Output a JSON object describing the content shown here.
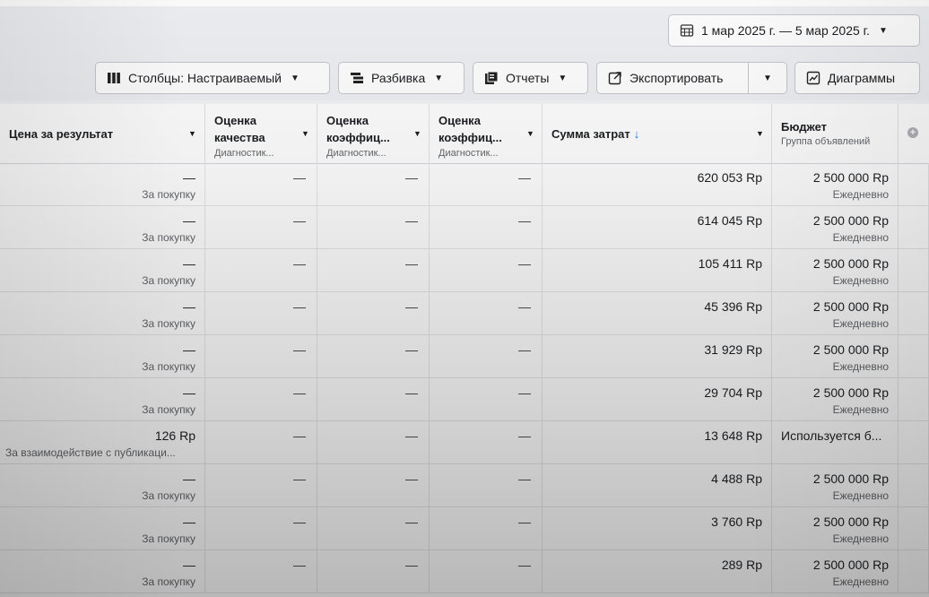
{
  "toolbar": {
    "date_range": "1 мар 2025 г. — 5 мар 2025 г.",
    "columns_label": "Столбцы: Настраиваемый",
    "breakdown_label": "Разбивка",
    "reports_label": "Отчеты",
    "export_label": "Экспортировать",
    "charts_label": "Диаграммы",
    "icons": [
      "calendar-icon",
      "columns-icon",
      "breakdown-icon",
      "reports-icon",
      "export-icon",
      "chart-icon"
    ]
  },
  "table": {
    "headers": {
      "price": "Цена за результат",
      "quality": "Оценка качества",
      "quality_sub": "Диагностик...",
      "engagement": "Оценка коэффиц...",
      "engagement_sub": "Диагностик...",
      "conversion": "Оценка коэффиц...",
      "conversion_sub": "Диагностик...",
      "spend": "Сумма затрат",
      "spend_sort": "↓",
      "budget": "Бюджет",
      "budget_sub": "Группа объявлений"
    },
    "rows": [
      {
        "price": "—",
        "price_sub": "За покупку",
        "quality": "—",
        "engagement": "—",
        "conversion": "—",
        "spend": "620 053 Rp",
        "budget": "2 500 000 Rp",
        "budget_sub": "Ежедневно"
      },
      {
        "price": "—",
        "price_sub": "За покупку",
        "quality": "—",
        "engagement": "—",
        "conversion": "—",
        "spend": "614 045 Rp",
        "budget": "2 500 000 Rp",
        "budget_sub": "Ежедневно"
      },
      {
        "price": "—",
        "price_sub": "За покупку",
        "quality": "—",
        "engagement": "—",
        "conversion": "—",
        "spend": "105 411 Rp",
        "budget": "2 500 000 Rp",
        "budget_sub": "Ежедневно"
      },
      {
        "price": "—",
        "price_sub": "За покупку",
        "quality": "—",
        "engagement": "—",
        "conversion": "—",
        "spend": "45 396 Rp",
        "budget": "2 500 000 Rp",
        "budget_sub": "Ежедневно"
      },
      {
        "price": "—",
        "price_sub": "За покупку",
        "quality": "—",
        "engagement": "—",
        "conversion": "—",
        "spend": "31 929 Rp",
        "budget": "2 500 000 Rp",
        "budget_sub": "Ежедневно"
      },
      {
        "price": "—",
        "price_sub": "За покупку",
        "quality": "—",
        "engagement": "—",
        "conversion": "—",
        "spend": "29 704 Rp",
        "budget": "2 500 000 Rp",
        "budget_sub": "Ежедневно"
      },
      {
        "price": "126 Rp",
        "price_sub": "За взаимодействие с публикаци...",
        "quality": "—",
        "engagement": "—",
        "conversion": "—",
        "spend": "13 648 Rp",
        "budget": "Используется б...",
        "budget_sub": ""
      },
      {
        "price": "—",
        "price_sub": "За покупку",
        "quality": "—",
        "engagement": "—",
        "conversion": "—",
        "spend": "4 488 Rp",
        "budget": "2 500 000 Rp",
        "budget_sub": "Ежедневно"
      },
      {
        "price": "—",
        "price_sub": "За покупку",
        "quality": "—",
        "engagement": "—",
        "conversion": "—",
        "spend": "3 760 Rp",
        "budget": "2 500 000 Rp",
        "budget_sub": "Ежедневно"
      },
      {
        "price": "—",
        "price_sub": "За покупку",
        "quality": "—",
        "engagement": "—",
        "conversion": "—",
        "spend": "289 Rp",
        "budget": "2 500 000 Rp",
        "budget_sub": "Ежедневно"
      }
    ]
  }
}
